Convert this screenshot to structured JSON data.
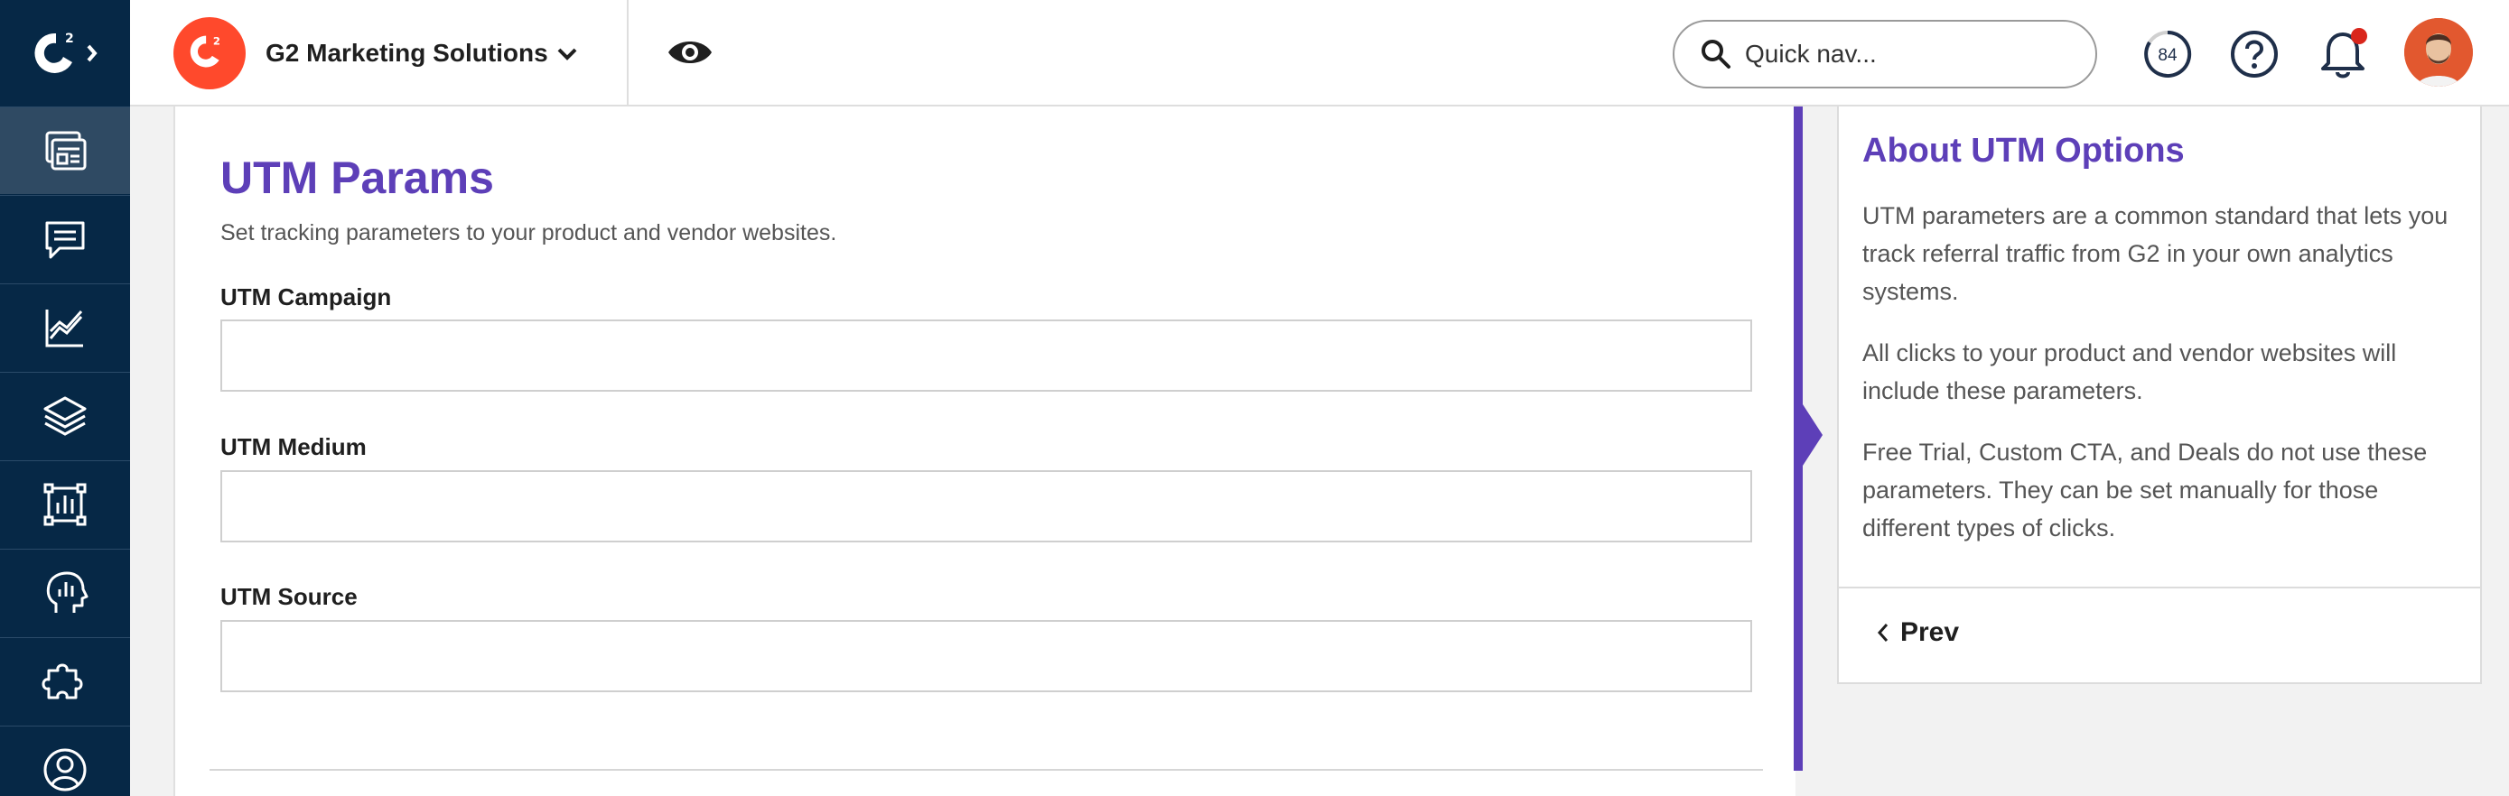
{
  "header": {
    "org_name": "G2 Marketing Solutions",
    "search_placeholder": "Quick nav...",
    "score": "84"
  },
  "sidebar": {
    "items": [
      {
        "icon": "product-profile-icon",
        "active": true
      },
      {
        "icon": "chat-icon",
        "active": false
      },
      {
        "icon": "analytics-chart-icon",
        "active": false
      },
      {
        "icon": "layers-icon",
        "active": false
      },
      {
        "icon": "report-frame-icon",
        "active": false
      },
      {
        "icon": "buyer-intent-head-icon",
        "active": false
      },
      {
        "icon": "integrations-puzzle-icon",
        "active": false
      },
      {
        "icon": "account-user-icon",
        "active": false
      }
    ]
  },
  "main": {
    "title": "UTM Params",
    "subtitle": "Set tracking parameters to your product and vendor websites.",
    "fields": [
      {
        "label": "UTM Campaign",
        "value": ""
      },
      {
        "label": "UTM Medium",
        "value": ""
      },
      {
        "label": "UTM Source",
        "value": ""
      }
    ]
  },
  "panel": {
    "title": "About UTM Options",
    "paragraphs": [
      "UTM parameters are a common standard that lets you track referral traffic from G2 in your own analytics systems.",
      "All clicks to your product and vendor websites will include these parameters.",
      "Free Trial, Custom CTA, and Deals do not use these parameters. They can be set manually for those different types of clicks."
    ],
    "prev_label": "Prev"
  },
  "colors": {
    "accent_purple": "#5d3fb8",
    "nav_navy": "#062846",
    "brand_red": "#ff492c",
    "notification_dot": "#d9261c"
  }
}
